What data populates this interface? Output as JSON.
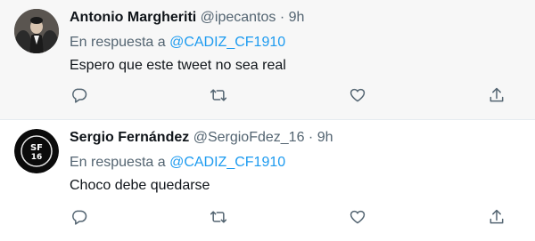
{
  "tweets": [
    {
      "name": "Antonio Margheriti",
      "handle": "@ipecantos",
      "separator": "·",
      "time": "9h",
      "reply_prefix": "En respuesta a",
      "reply_mention": "@CADIZ_CF1910",
      "text": "Espero que este tweet no sea real"
    },
    {
      "name": "Sergio Fernández",
      "handle": "@SergioFdez_16",
      "separator": "·",
      "time": "9h",
      "reply_prefix": "En respuesta a",
      "reply_mention": "@CADIZ_CF1910",
      "text": "Choco debe quedarse",
      "avatar_text_top": "SF",
      "avatar_text_bottom": "16"
    }
  ],
  "colors": {
    "accent": "#1d9bf0",
    "muted": "#536471",
    "highlight_bg": "#f7f7f7"
  },
  "icons": [
    "reply-icon",
    "retweet-icon",
    "like-icon",
    "share-icon"
  ]
}
